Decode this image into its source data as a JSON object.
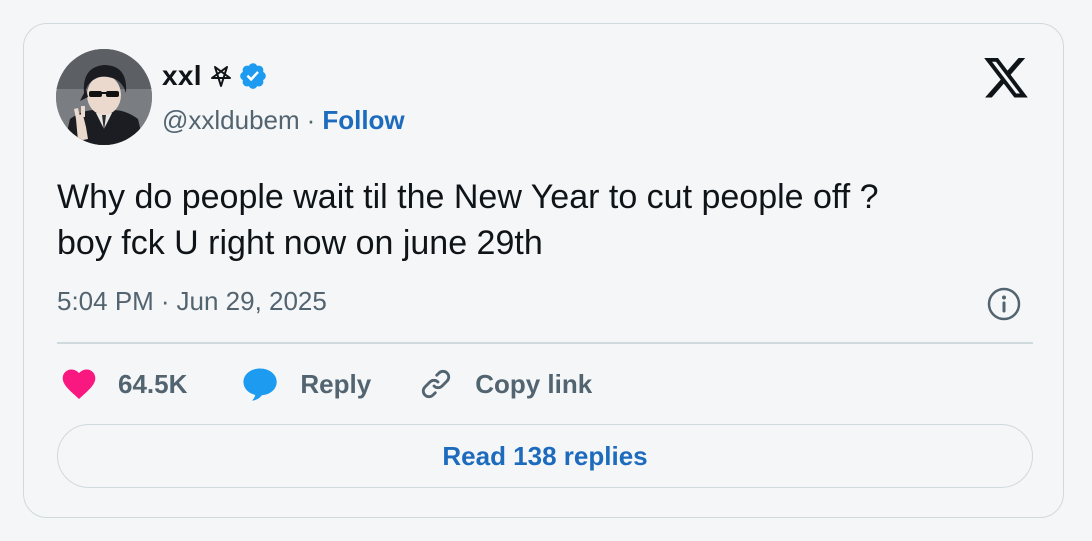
{
  "author": {
    "display_name": "xxl",
    "name_emoji": "pentagram-icon",
    "verified": true,
    "verified_icon": "verified-badge-icon",
    "handle": "@xxldubem",
    "separator": "·",
    "follow_label": "Follow",
    "avatar_icon": "profile-avatar"
  },
  "platform_logo": "x-logo-icon",
  "tweet": {
    "lines": [
      "Why do people wait til the New Year to cut people off ?",
      "boy fck U right now on june 29th"
    ],
    "time": "5:04 PM",
    "separator": "·",
    "date": "Jun 29, 2025",
    "info_icon": "info-icon"
  },
  "actions": {
    "like": {
      "icon": "heart-icon",
      "label": "64.5K"
    },
    "reply": {
      "icon": "speech-bubble-icon",
      "label": "Reply"
    },
    "copy": {
      "icon": "link-icon",
      "label": "Copy link"
    }
  },
  "read_replies_label": "Read 138 replies",
  "colors": {
    "accent": "#1d6bbd",
    "verified": "#1d9bf0",
    "like": "#f91880",
    "reply": "#1d9bf0",
    "text": "#0f1419",
    "muted": "#536471",
    "border": "#cfd9de"
  }
}
